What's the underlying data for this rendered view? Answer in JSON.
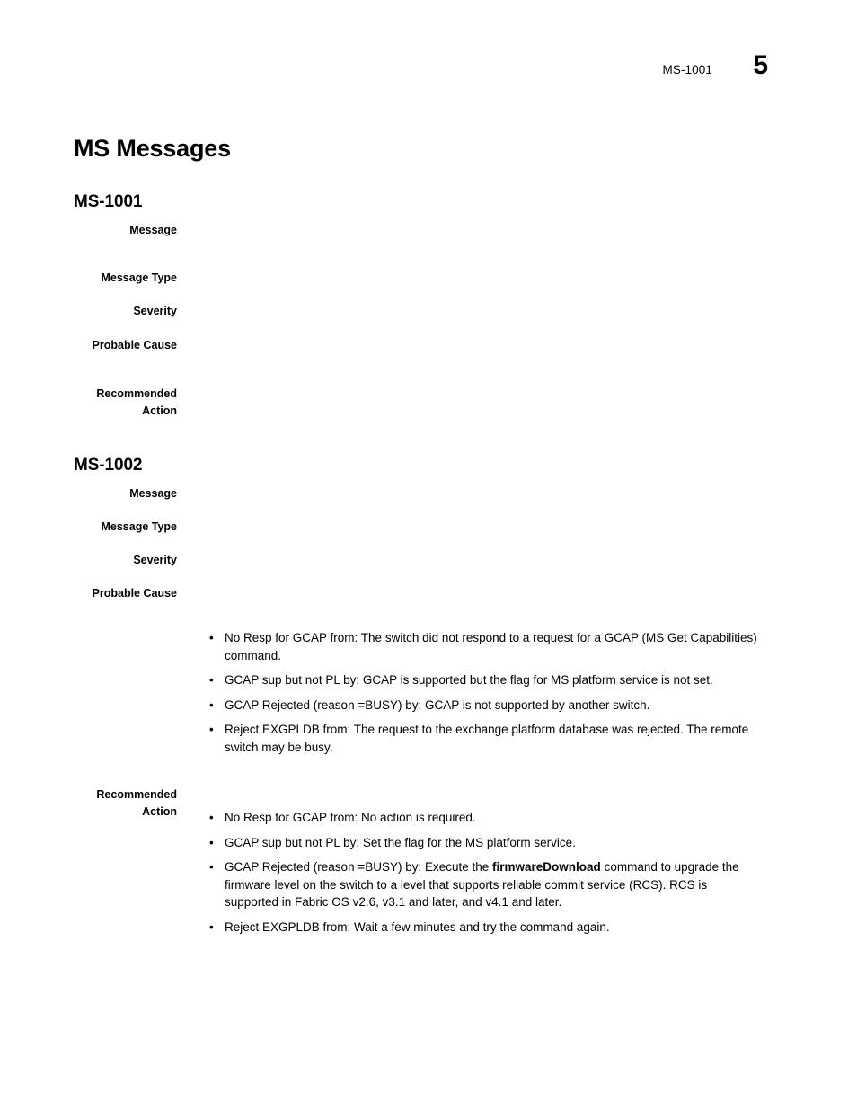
{
  "header": {
    "reference": "MS-1001",
    "page_number": "5"
  },
  "chapter": {
    "title": "MS Messages"
  },
  "sections": [
    {
      "heading": "MS-1001",
      "entries": [
        {
          "label": "Message",
          "body": ""
        },
        {
          "label": "Message Type",
          "body": ""
        },
        {
          "label": "Severity",
          "body": ""
        },
        {
          "label": "Probable Cause",
          "body": ""
        },
        {
          "label": "Recommended\nAction",
          "body": ""
        }
      ]
    },
    {
      "heading": "MS-1002",
      "entries": [
        {
          "label": "Message",
          "body": ""
        },
        {
          "label": "Message Type",
          "body": ""
        },
        {
          "label": "Severity",
          "body": ""
        },
        {
          "label": "Probable Cause",
          "body": ""
        },
        {
          "label": "Recommended\nAction",
          "body": ""
        }
      ]
    }
  ],
  "probable_cause_bullets": [
    {
      "text": "No Resp for GCAP from: The switch did not respond to a request for a GCAP (MS Get Capabilities) command."
    },
    {
      "text": "GCAP sup but not PL by: GCAP is supported but the flag for MS platform service is not set."
    },
    {
      "text": "GCAP Rejected (reason =BUSY) by: GCAP is not supported by another switch."
    },
    {
      "text": "Reject EXGPLDB from: The request to the exchange platform database was rejected. The remote switch may be busy."
    }
  ],
  "recommended_action_bullets": [
    {
      "pre": "No Resp for GCAP from: No action is required.",
      "command": "",
      "post": ""
    },
    {
      "pre": "GCAP sup but not PL by: Set the flag for the MS platform service.",
      "command": "",
      "post": ""
    },
    {
      "pre": "GCAP Rejected (reason =BUSY) by: Execute the ",
      "command": "firmwareDownload",
      "post": " command to upgrade the firmware level on the switch to a level that supports reliable commit service (RCS). RCS is supported in Fabric OS v2.6, v3.1 and later, and v4.1 and later."
    },
    {
      "pre": "Reject EXGPLDB from: Wait a few minutes and try the command again.",
      "command": "",
      "post": ""
    }
  ],
  "bullet_glyph": "•"
}
